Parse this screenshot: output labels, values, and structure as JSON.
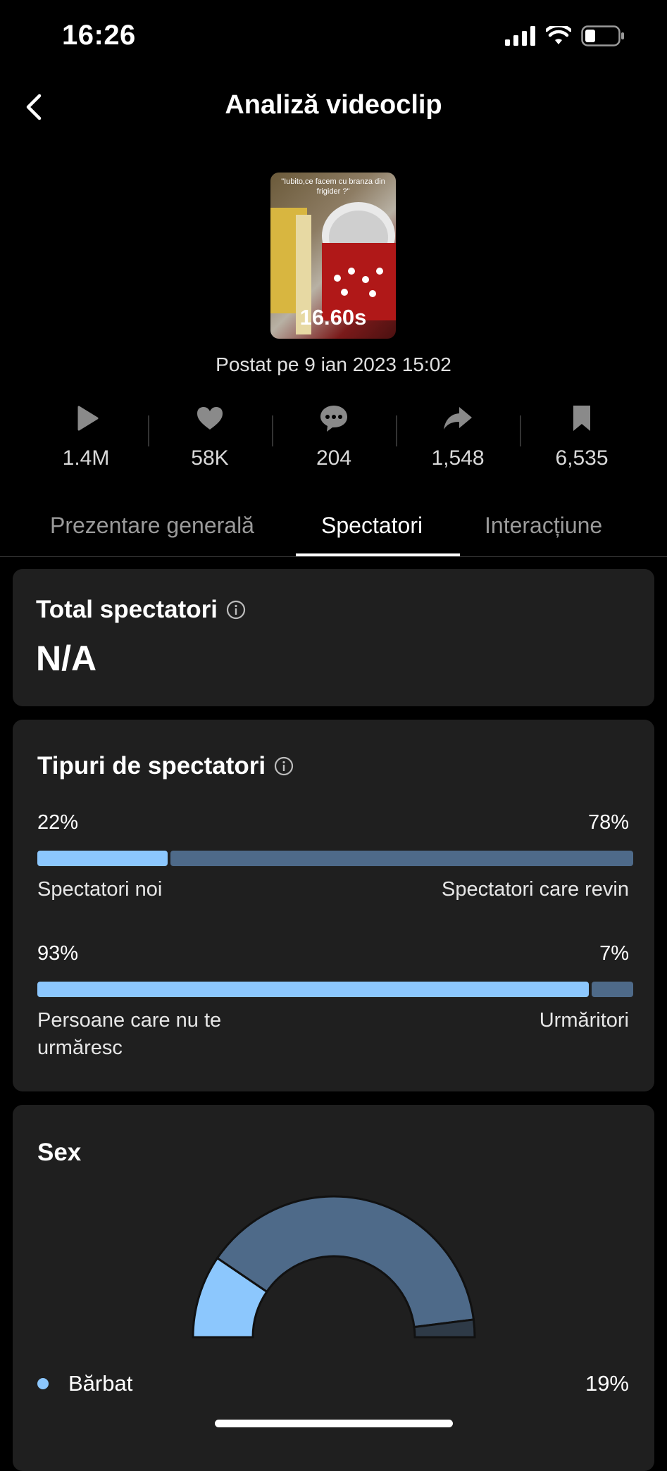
{
  "status_bar": {
    "time": "16:26"
  },
  "header": {
    "title": "Analiză videoclip"
  },
  "video": {
    "caption": "\"Iubito,ce facem cu branza din frigider ?\"",
    "duration": "16.60s",
    "posted": "Postat pe 9 ian 2023 15:02"
  },
  "stats": [
    {
      "icon": "play-icon",
      "value": "1.4M"
    },
    {
      "icon": "heart-icon",
      "value": "58K"
    },
    {
      "icon": "comment-icon",
      "value": "204"
    },
    {
      "icon": "share-icon",
      "value": "1,548"
    },
    {
      "icon": "bookmark-icon",
      "value": "6,535"
    }
  ],
  "tabs": [
    {
      "label": "Prezentare generală",
      "active": false
    },
    {
      "label": "Spectatori",
      "active": true
    },
    {
      "label": "Interacțiune",
      "active": false
    }
  ],
  "total_viewers": {
    "title": "Total spectatori",
    "value": "N/A"
  },
  "viewer_types": {
    "title": "Tipuri de spectatori",
    "new_vs_returning": {
      "left_pct": "22%",
      "right_pct": "78%",
      "left_label": "Spectatori noi",
      "right_label": "Spectatori care revin",
      "left_fraction": 0.22
    },
    "followers": {
      "left_pct": "93%",
      "right_pct": "7%",
      "left_label": "Persoane care nu te urmăresc",
      "right_label": "Urmăritori",
      "left_fraction": 0.93
    }
  },
  "sex": {
    "title": "Sex",
    "legend": [
      {
        "label": "Bărbat",
        "pct": "19%"
      }
    ],
    "chart_data": {
      "type": "pie",
      "slices": [
        {
          "label": "Bărbat",
          "value": 19,
          "color": "#8cc7fd"
        },
        {
          "value": 77,
          "color": "#4e6a89"
        },
        {
          "value": 4,
          "color": "#2e3a47"
        }
      ]
    }
  },
  "colors": {
    "accent": "#8cc7fd",
    "secondary": "#4e6a89",
    "card": "#1f1f1f"
  }
}
